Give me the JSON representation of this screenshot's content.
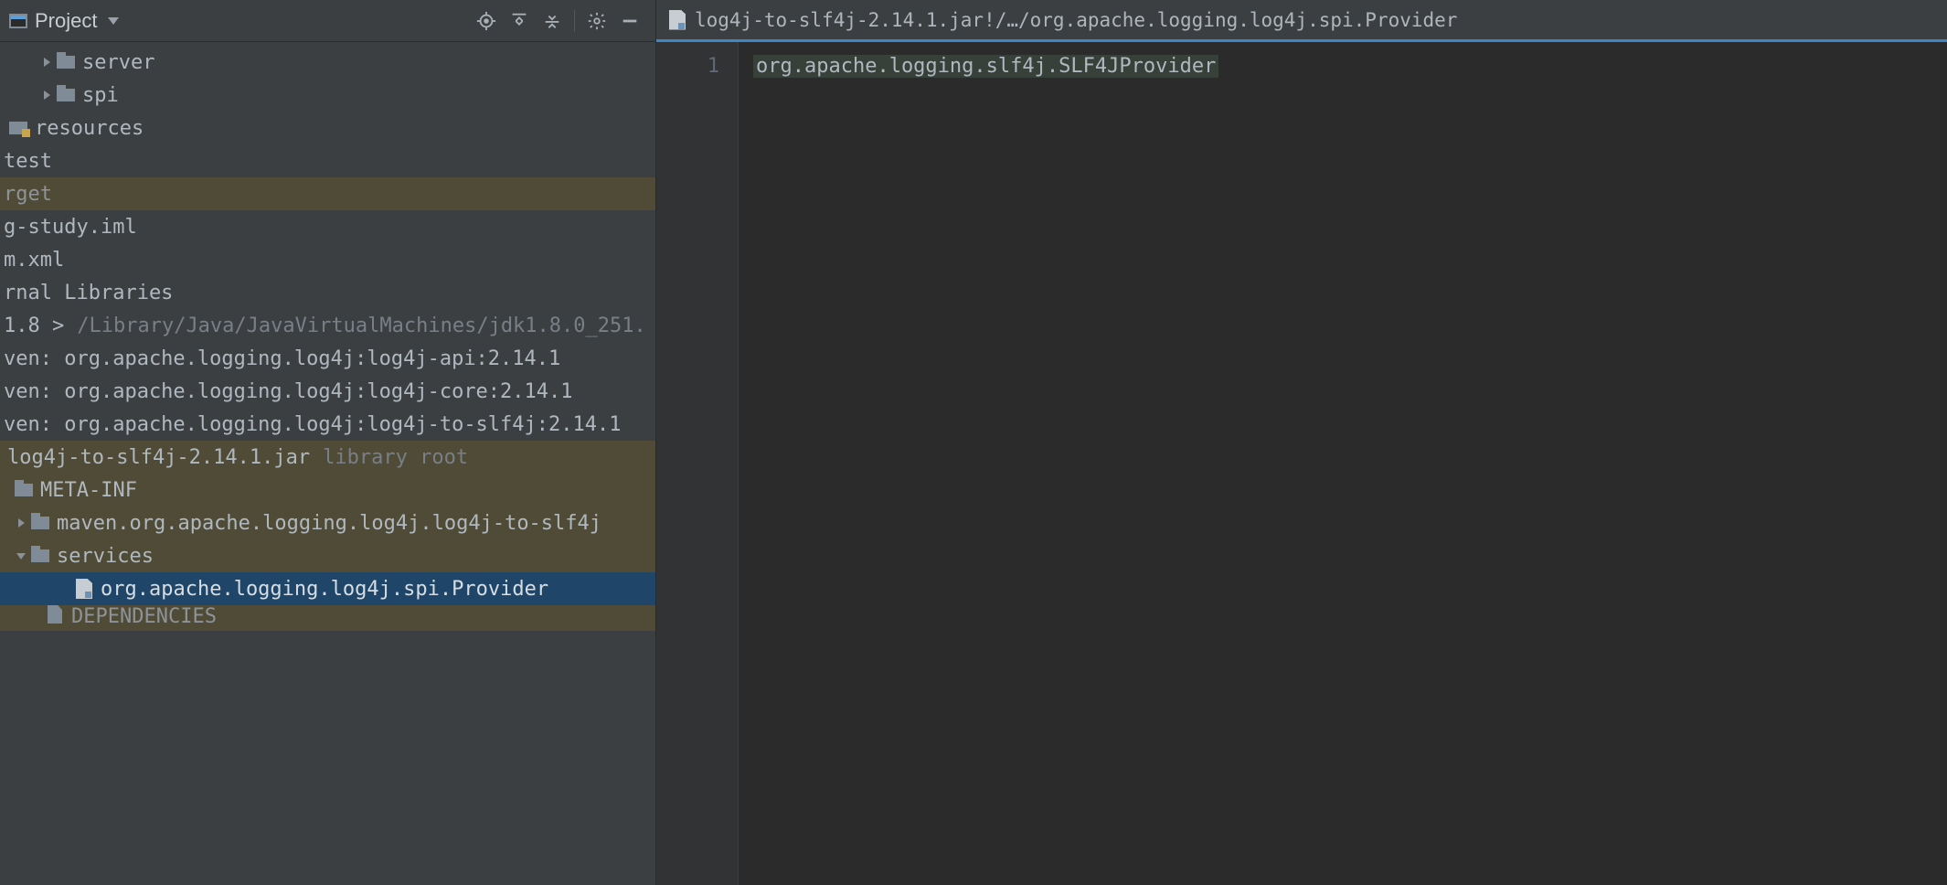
{
  "sidebar": {
    "title": "Project",
    "tree": {
      "server": {
        "label": "server"
      },
      "spi": {
        "label": "spi"
      },
      "resources": {
        "label": "resources"
      },
      "test": {
        "label": "test"
      },
      "target": {
        "label": "rget"
      },
      "iml": {
        "label": "g-study.iml"
      },
      "pom": {
        "label": "m.xml"
      },
      "extlib": {
        "label": "rnal Libraries"
      },
      "jdk": {
        "label": "1.8 >",
        "path": "/Library/Java/JavaVirtualMachines/jdk1.8.0_251."
      },
      "maven_api": {
        "label": "ven: org.apache.logging.log4j:log4j-api:2.14.1"
      },
      "maven_core": {
        "label": "ven: org.apache.logging.log4j:log4j-core:2.14.1"
      },
      "maven_slf4j": {
        "label": "ven: org.apache.logging.log4j:log4j-to-slf4j:2.14.1"
      },
      "jar": {
        "label": "log4j-to-slf4j-2.14.1.jar",
        "suffix": "library root"
      },
      "metainf": {
        "label": "META-INF"
      },
      "mavenpkg": {
        "label": "maven.org.apache.logging.log4j.log4j-to-slf4j"
      },
      "services": {
        "label": "services"
      },
      "provider": {
        "label": "org.apache.logging.log4j.spi.Provider"
      },
      "deps": {
        "label": "DEPENDENCIES"
      }
    }
  },
  "editor": {
    "tab": "log4j-to-slf4j-2.14.1.jar!/…/org.apache.logging.log4j.spi.Provider",
    "gutter": {
      "line1": "1"
    },
    "code": {
      "line1": "org.apache.logging.slf4j.SLF4JProvider"
    }
  }
}
